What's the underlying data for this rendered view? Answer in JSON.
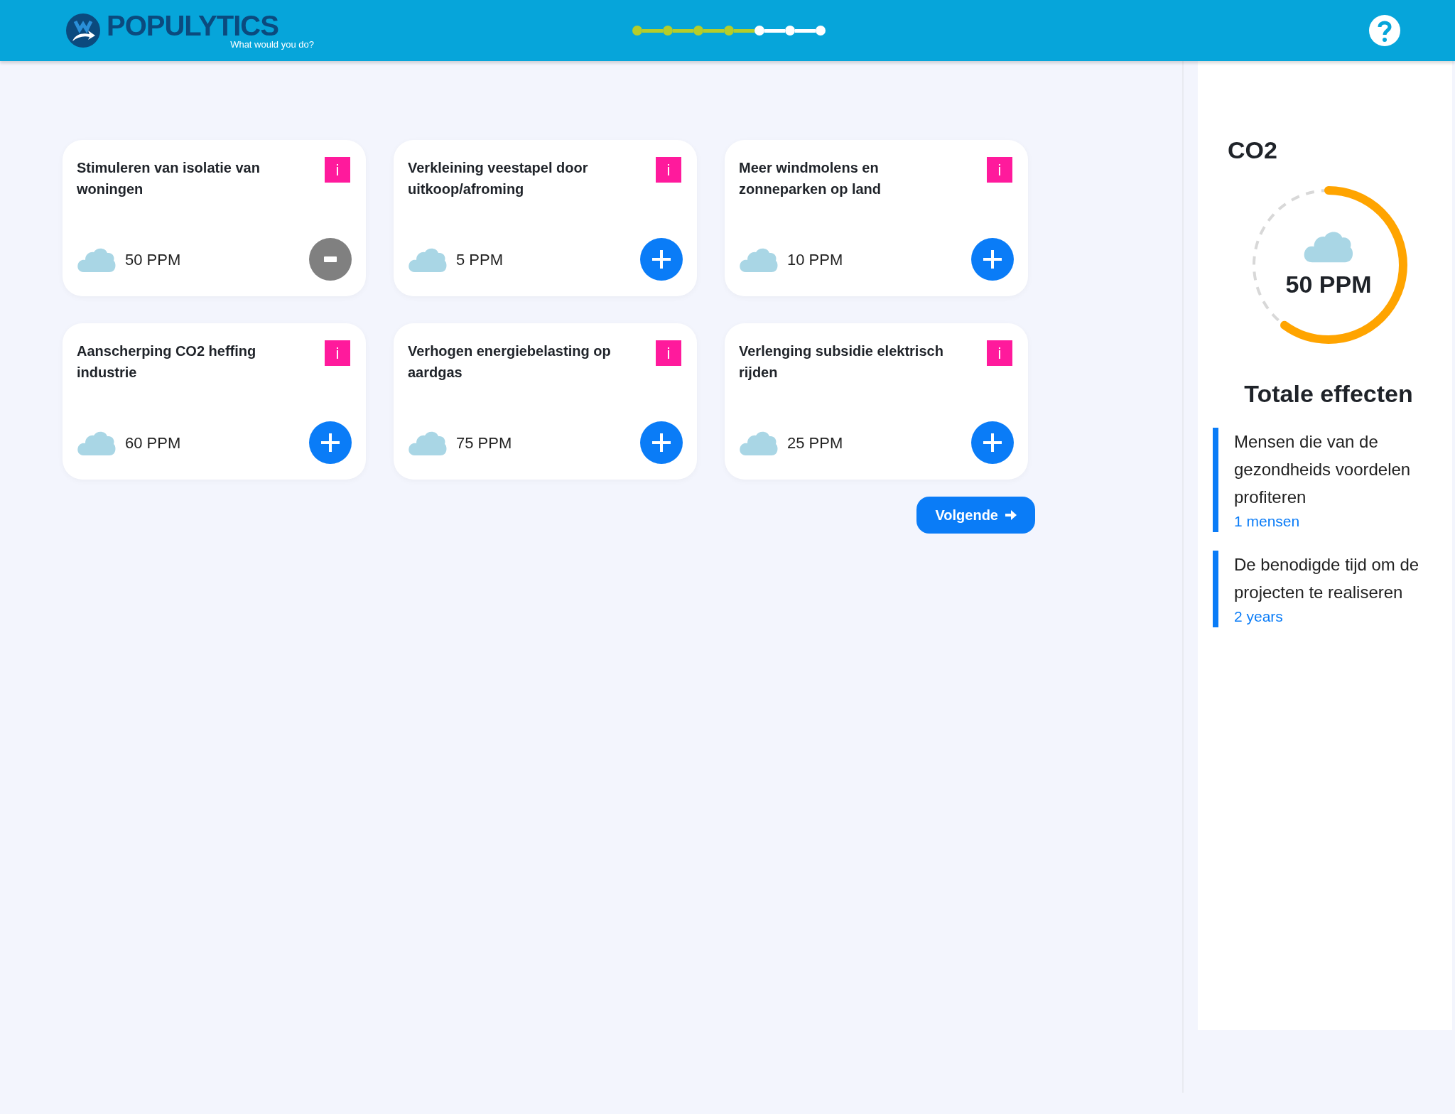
{
  "header": {
    "brand": "POPULYTICS",
    "tagline": "What would you do?",
    "steps": [
      {
        "done": true
      },
      {
        "done": true
      },
      {
        "done": true
      },
      {
        "done": true
      },
      {
        "done": false
      },
      {
        "done": false
      },
      {
        "done": false
      }
    ]
  },
  "cards": [
    {
      "title": "Stimuleren van isolatie van woningen",
      "info": "i",
      "effect": "50 PPM",
      "selected": true
    },
    {
      "title": "Verkleining veestapel door uitkoop/afroming",
      "info": "i",
      "effect": "5 PPM",
      "selected": false
    },
    {
      "title": "Meer windmolens en zonneparken op land",
      "info": "i",
      "effect": "10 PPM",
      "selected": false
    },
    {
      "title": "Aanscherping CO2 heffing industrie",
      "info": "i",
      "effect": "60 PPM",
      "selected": false
    },
    {
      "title": "Verhogen energiebelasting op aardgas",
      "info": "i",
      "effect": "75 PPM",
      "selected": false
    },
    {
      "title": "Verlenging subsidie elektrisch rijden",
      "info": "i",
      "effect": "25 PPM",
      "selected": false
    }
  ],
  "next_button": "Volgende",
  "sidebar": {
    "title": "CO2",
    "gauge": {
      "reading": "50 PPM",
      "level": 0.6
    },
    "heading": "Totale effecten",
    "effects": [
      {
        "label": "Mensen die van de gezondheids voordelen profiteren",
        "value": "1 mensen"
      },
      {
        "label": "De benodigde tijd om de projecten te realiseren",
        "value": "2 years"
      }
    ]
  }
}
